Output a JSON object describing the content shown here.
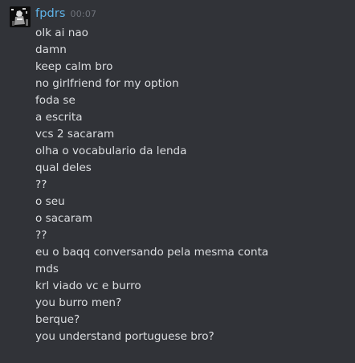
{
  "message": {
    "author": "fpdrs",
    "timestamp": "00:07",
    "lines": [
      "olk ai nao",
      "damn",
      "keep calm bro",
      "no girlfriend for my option",
      "foda se",
      "a escrita",
      "vcs 2 sacaram",
      "olha o vocabulario da lenda",
      "qual deles",
      "??",
      "o seu",
      "o sacaram",
      "??",
      "eu o baqq conversando pela mesma conta",
      "mds",
      "krl viado vc e burro",
      "you burro men?",
      "berque?",
      "you understand portuguese bro?"
    ]
  },
  "colors": {
    "background": "#313338",
    "username": "#5fb3e8",
    "timestamp": "#6f737b",
    "text": "#dcdee1"
  }
}
